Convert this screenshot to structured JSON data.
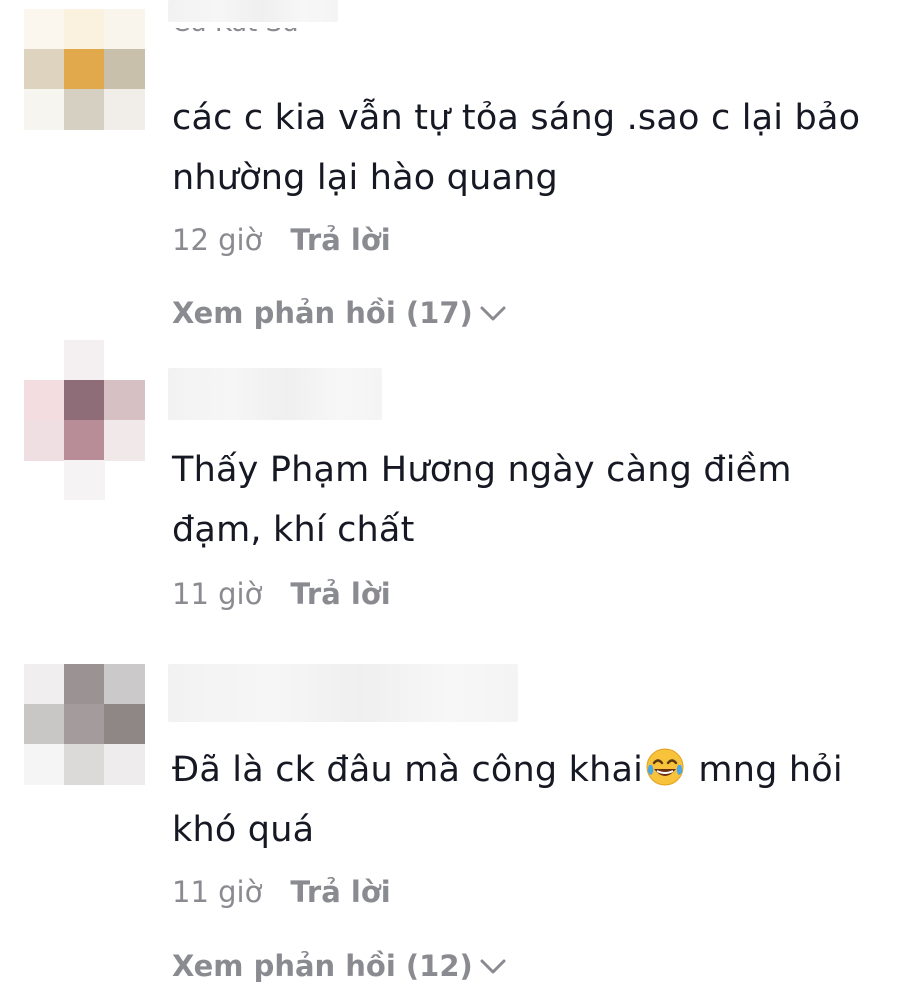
{
  "comments": [
    {
      "text": "các c kia vẫn tự tỏa sáng .sao c lại bảo nhường lại hào quang",
      "time": "12 giờ",
      "reply_label": "Trả lời",
      "view_replies": "Xem phản hồi (17)"
    },
    {
      "text": "Thấy Phạm Hương ngày càng điềm đạm, khí chất",
      "time": "11 giờ",
      "reply_label": "Trả lời"
    },
    {
      "text_before": "Đã là ck đâu mà công khai",
      "text_after": " mng hỏi khó quá",
      "emoji": "face-with-tears-of-joy-icon",
      "time": "11 giờ",
      "reply_label": "Trả lời",
      "view_replies": "Xem phản hồi (12)"
    }
  ],
  "colors": {
    "text": "#161823",
    "muted": "#8a8b91"
  }
}
